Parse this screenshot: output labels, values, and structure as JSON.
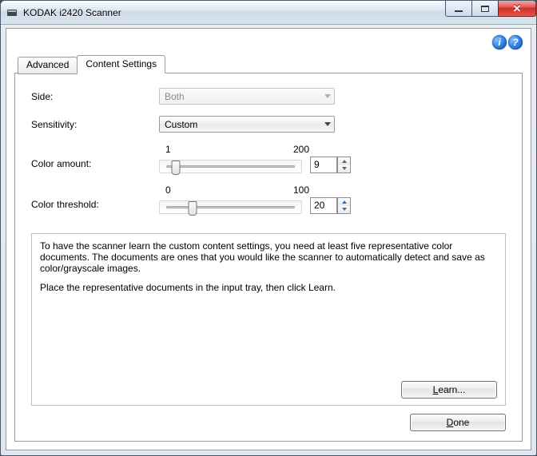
{
  "window": {
    "title": "KODAK i2420 Scanner"
  },
  "win_controls": {
    "min": "minimize",
    "max": "maximize",
    "close": "close"
  },
  "help_icons": {
    "info": "i",
    "help": "?"
  },
  "tabs": {
    "advanced": "Advanced",
    "content": "Content Settings"
  },
  "labels": {
    "side": "Side:",
    "sensitivity": "Sensitivity:",
    "color_amount": "Color amount:",
    "color_threshold": "Color threshold:"
  },
  "side": {
    "value": "Both"
  },
  "sensitivity": {
    "value": "Custom"
  },
  "color_amount": {
    "min": "1",
    "max": "200",
    "value": "9",
    "pos_pct": 7
  },
  "color_threshold": {
    "min": "0",
    "max": "100",
    "value": "20",
    "pos_pct": 20
  },
  "info": {
    "para1": "To have the scanner learn the custom content settings, you need at least five representative color documents. The documents are ones that you would like the scanner to automatically detect and save as color/grayscale images.",
    "para2": "Place the representative documents in the input tray, then click Learn."
  },
  "buttons": {
    "learn_prefix": "L",
    "learn_rest": "earn...",
    "done_prefix": "D",
    "done_rest": "one"
  }
}
